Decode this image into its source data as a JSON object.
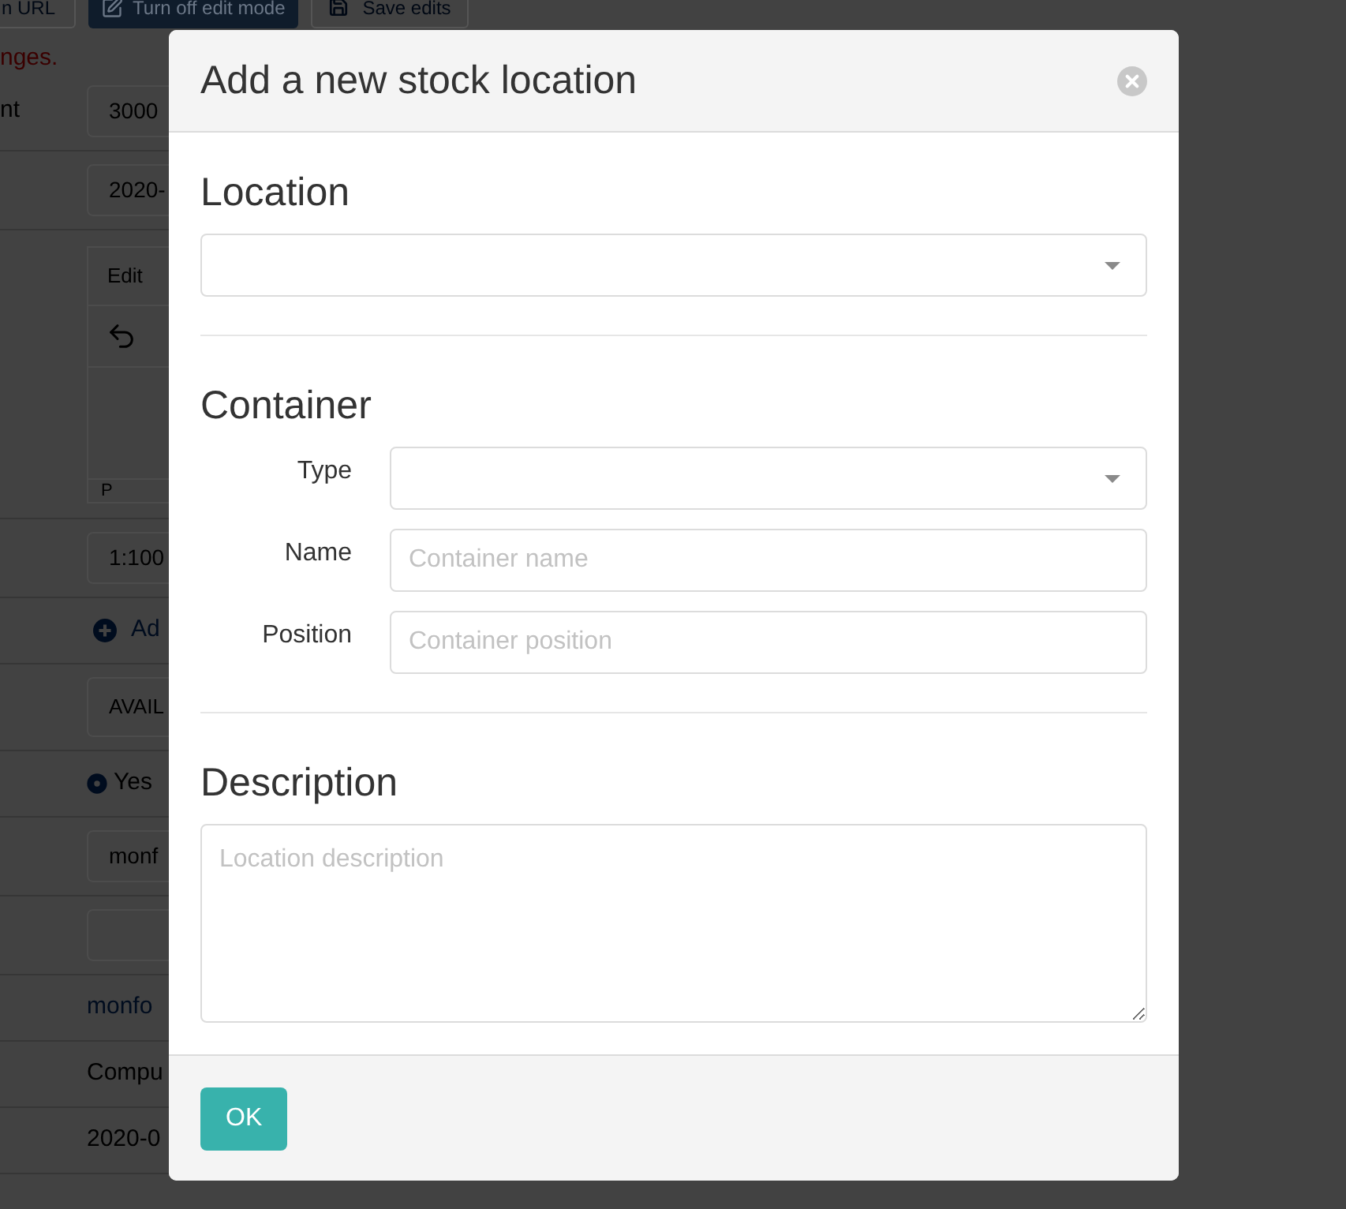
{
  "background_page": {
    "toolbar": [
      {
        "kind": "link",
        "label": "n URL"
      },
      {
        "kind": "toggle",
        "label": "Turn off edit mode"
      },
      {
        "kind": "save",
        "label": "Save edits"
      }
    ],
    "notice": "nges.",
    "rows": [
      {
        "kind": "input",
        "label": "nt",
        "value": "3000"
      },
      {
        "kind": "input",
        "value": "2020-"
      },
      {
        "kind": "editor",
        "menu": [
          "Edit"
        ],
        "status": "P"
      },
      {
        "kind": "input",
        "value": "1:100"
      },
      {
        "kind": "add-link",
        "text": "Ad"
      },
      {
        "kind": "select",
        "value": "AVAIL"
      },
      {
        "kind": "radio",
        "label": "Yes",
        "selected": true
      },
      {
        "kind": "input",
        "value": "monf"
      },
      {
        "kind": "input"
      },
      {
        "kind": "link",
        "text": "monfo"
      },
      {
        "kind": "text",
        "text": "Compu"
      },
      {
        "kind": "text",
        "text": "2020-0"
      }
    ]
  },
  "dialog": {
    "title": "Add a new stock location",
    "sections": [
      {
        "heading": "Location",
        "fields": [
          {
            "kind": "select"
          }
        ]
      },
      {
        "heading": "Container",
        "fields": [
          {
            "kind": "select",
            "label": "Type"
          },
          {
            "kind": "input",
            "label": "Name",
            "placeholder": "Container name"
          },
          {
            "kind": "input",
            "label": "Position",
            "placeholder": "Container position"
          }
        ]
      },
      {
        "heading": "Description",
        "fields": [
          {
            "kind": "textarea",
            "placeholder": "Location description"
          }
        ]
      }
    ],
    "buttons": [
      {
        "label": "OK"
      }
    ]
  }
}
